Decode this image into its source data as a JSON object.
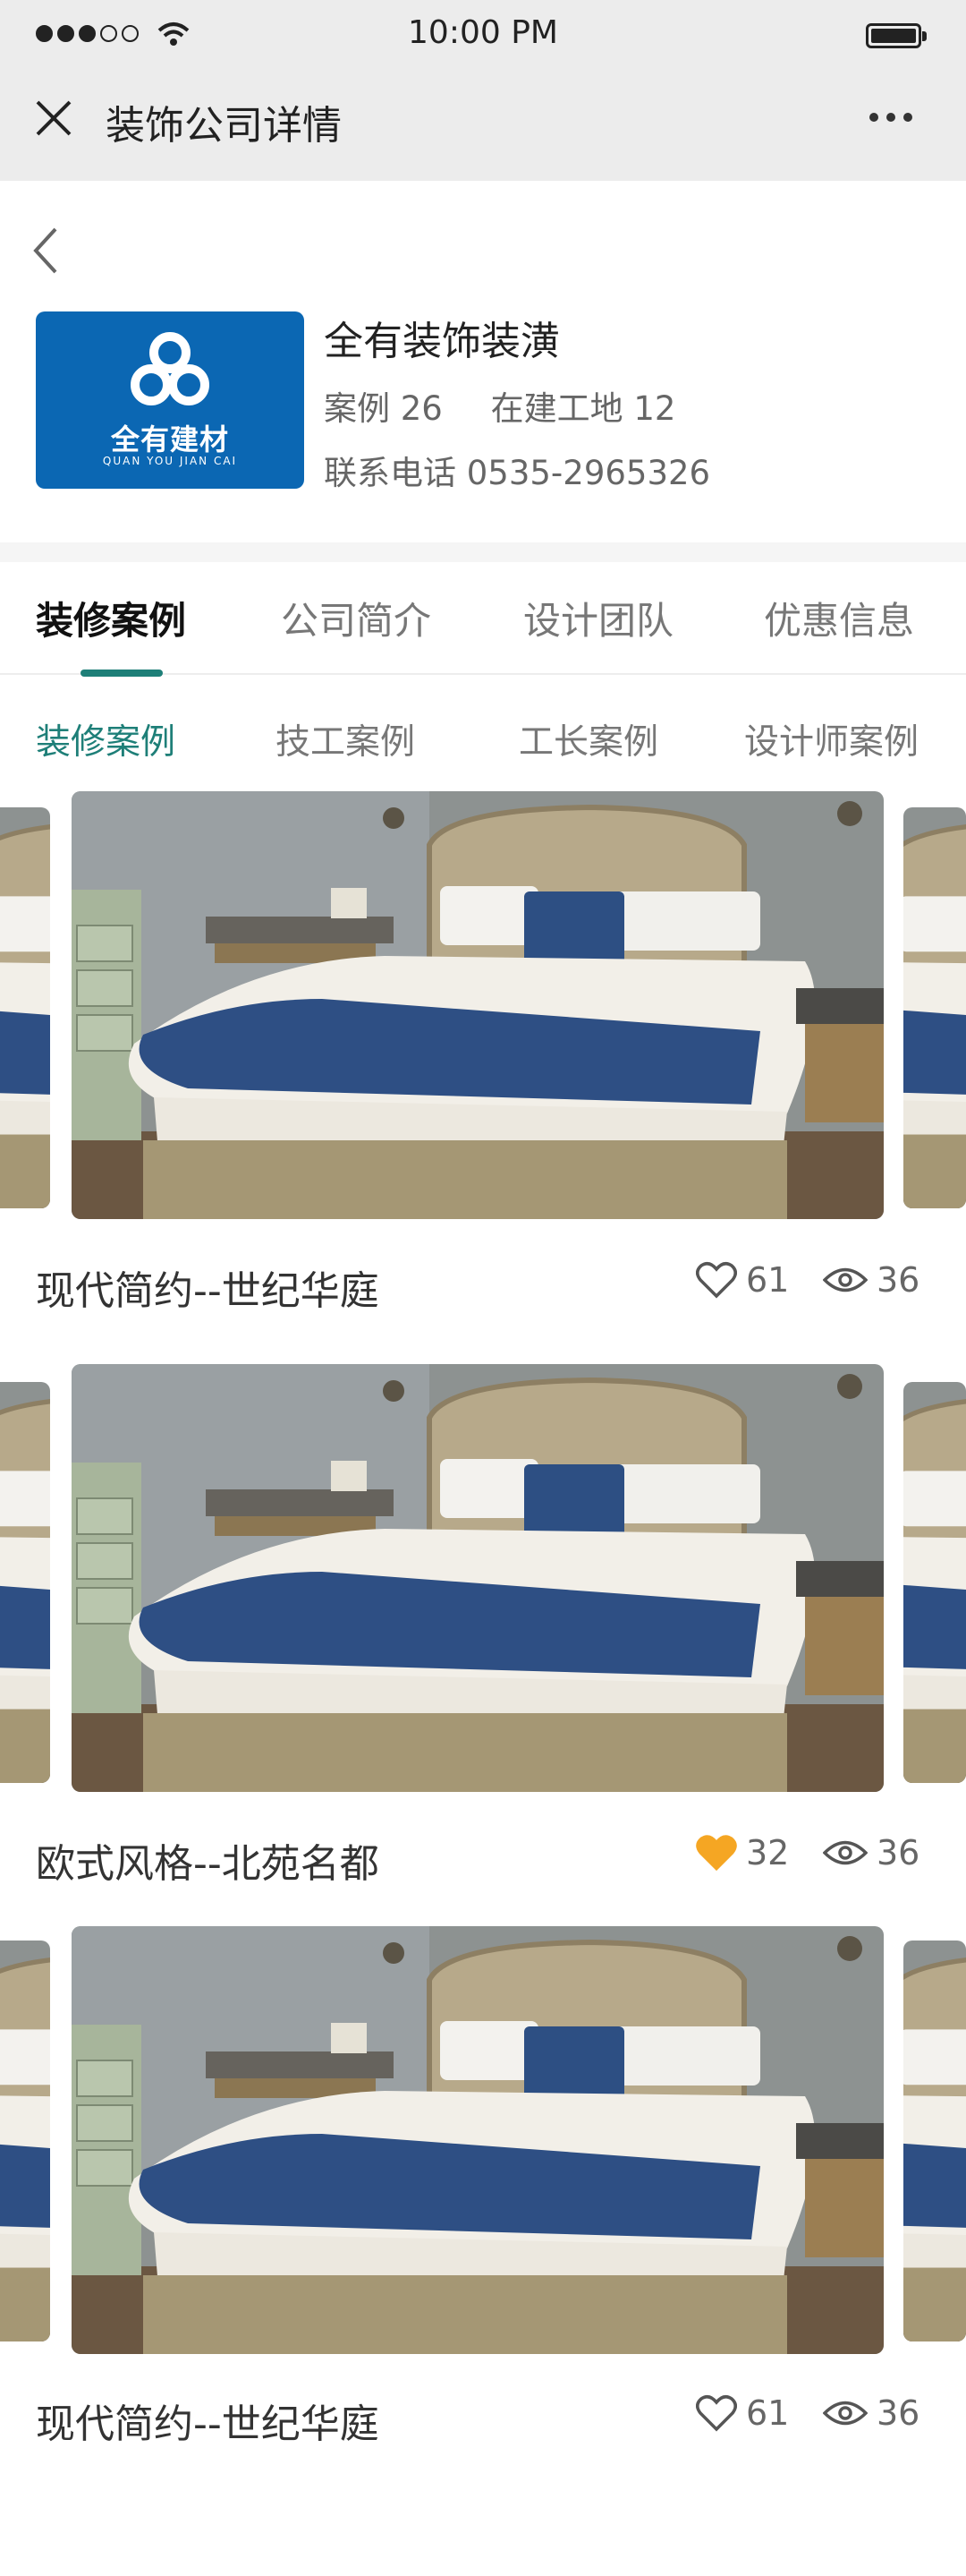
{
  "status_bar": {
    "time": "10:00 PM"
  },
  "nav": {
    "title": "装饰公司详情"
  },
  "company": {
    "name": "全有装饰装潢",
    "logo_text": "全有建材",
    "logo_sub": "QUAN YOU JIAN CAI",
    "cases_label": "案例",
    "cases_value": "26",
    "sites_label": "在建工地",
    "sites_value": "12",
    "phone_label": "联系电话",
    "phone_value": "0535-2965326"
  },
  "tabs": [
    "装修案例",
    "公司简介",
    "设计团队",
    "优惠信息"
  ],
  "subtabs": [
    "装修案例",
    "技工案例",
    "工长案例",
    "设计师案例"
  ],
  "cases": [
    {
      "title": "现代简约--世纪华庭",
      "likes": "61",
      "views": "36",
      "liked": false
    },
    {
      "title": "欧式风格--北苑名都",
      "likes": "32",
      "views": "36",
      "liked": true
    },
    {
      "title": "现代简约--世纪华庭",
      "likes": "61",
      "views": "36",
      "liked": false
    }
  ],
  "colors": {
    "accent": "#1e7f78",
    "like_active": "#f5a623",
    "logo_bg": "#0b67b3"
  }
}
